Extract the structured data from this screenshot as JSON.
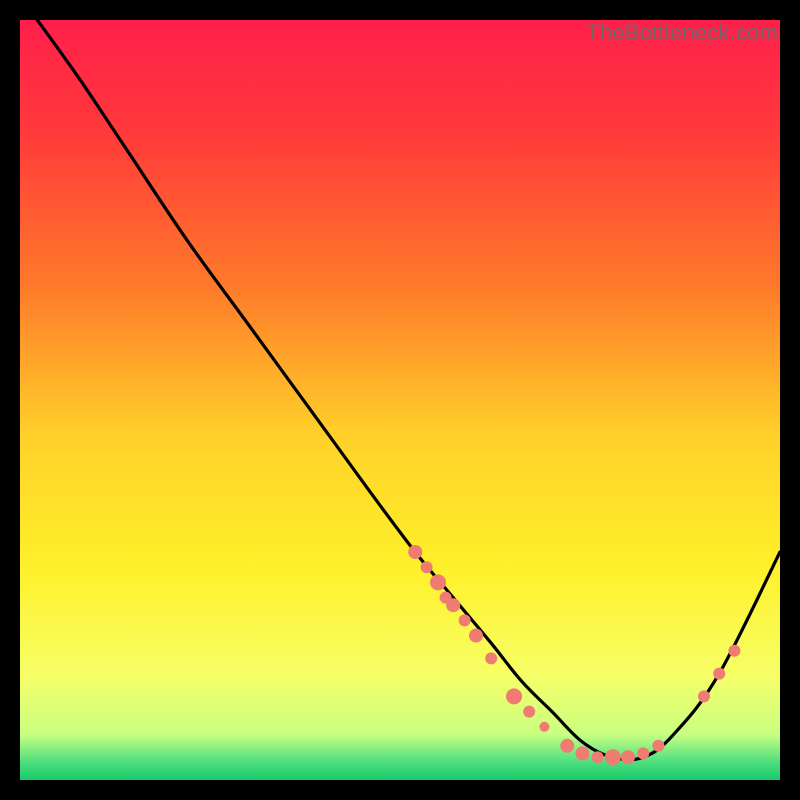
{
  "watermark": "TheBottleneck.com",
  "chart_data": {
    "type": "line",
    "title": "",
    "xlabel": "",
    "ylabel": "",
    "xlim": [
      0,
      100
    ],
    "ylim": [
      0,
      100
    ],
    "gradient_stops": [
      {
        "offset": 0.0,
        "color": "#ff1f4b"
      },
      {
        "offset": 0.15,
        "color": "#ff3a3a"
      },
      {
        "offset": 0.35,
        "color": "#ff7a2a"
      },
      {
        "offset": 0.55,
        "color": "#ffd22a"
      },
      {
        "offset": 0.72,
        "color": "#fff02a"
      },
      {
        "offset": 0.86,
        "color": "#f7ff66"
      },
      {
        "offset": 0.94,
        "color": "#c8ff82"
      },
      {
        "offset": 0.975,
        "color": "#52e07f"
      },
      {
        "offset": 1.0,
        "color": "#18c96b"
      }
    ],
    "series": [
      {
        "name": "bottleneck-curve",
        "x": [
          0,
          3,
          8,
          14,
          22,
          30,
          38,
          46,
          52,
          57,
          62,
          66,
          70,
          74,
          78,
          82,
          86,
          92,
          100
        ],
        "y": [
          103,
          99,
          92,
          83,
          71,
          60,
          49,
          38,
          30,
          24,
          18,
          13,
          9,
          5,
          3,
          3,
          6,
          14,
          30
        ]
      }
    ],
    "scatter": {
      "name": "highlight-points",
      "color": "#ef7b72",
      "points": [
        {
          "x": 52,
          "y": 30,
          "r": 7
        },
        {
          "x": 53.5,
          "y": 28,
          "r": 6
        },
        {
          "x": 55,
          "y": 26,
          "r": 8
        },
        {
          "x": 56,
          "y": 24,
          "r": 6
        },
        {
          "x": 57,
          "y": 23,
          "r": 7
        },
        {
          "x": 58.5,
          "y": 21,
          "r": 6
        },
        {
          "x": 60,
          "y": 19,
          "r": 7
        },
        {
          "x": 62,
          "y": 16,
          "r": 6
        },
        {
          "x": 65,
          "y": 11,
          "r": 8
        },
        {
          "x": 67,
          "y": 9,
          "r": 6
        },
        {
          "x": 69,
          "y": 7,
          "r": 5
        },
        {
          "x": 72,
          "y": 4.5,
          "r": 7
        },
        {
          "x": 74,
          "y": 3.5,
          "r": 7
        },
        {
          "x": 76,
          "y": 3,
          "r": 6
        },
        {
          "x": 78,
          "y": 3,
          "r": 8
        },
        {
          "x": 80,
          "y": 3,
          "r": 7
        },
        {
          "x": 82,
          "y": 3.5,
          "r": 6
        },
        {
          "x": 84,
          "y": 4.5,
          "r": 6
        },
        {
          "x": 90,
          "y": 11,
          "r": 6
        },
        {
          "x": 92,
          "y": 14,
          "r": 6
        },
        {
          "x": 94,
          "y": 17,
          "r": 6
        }
      ]
    }
  }
}
